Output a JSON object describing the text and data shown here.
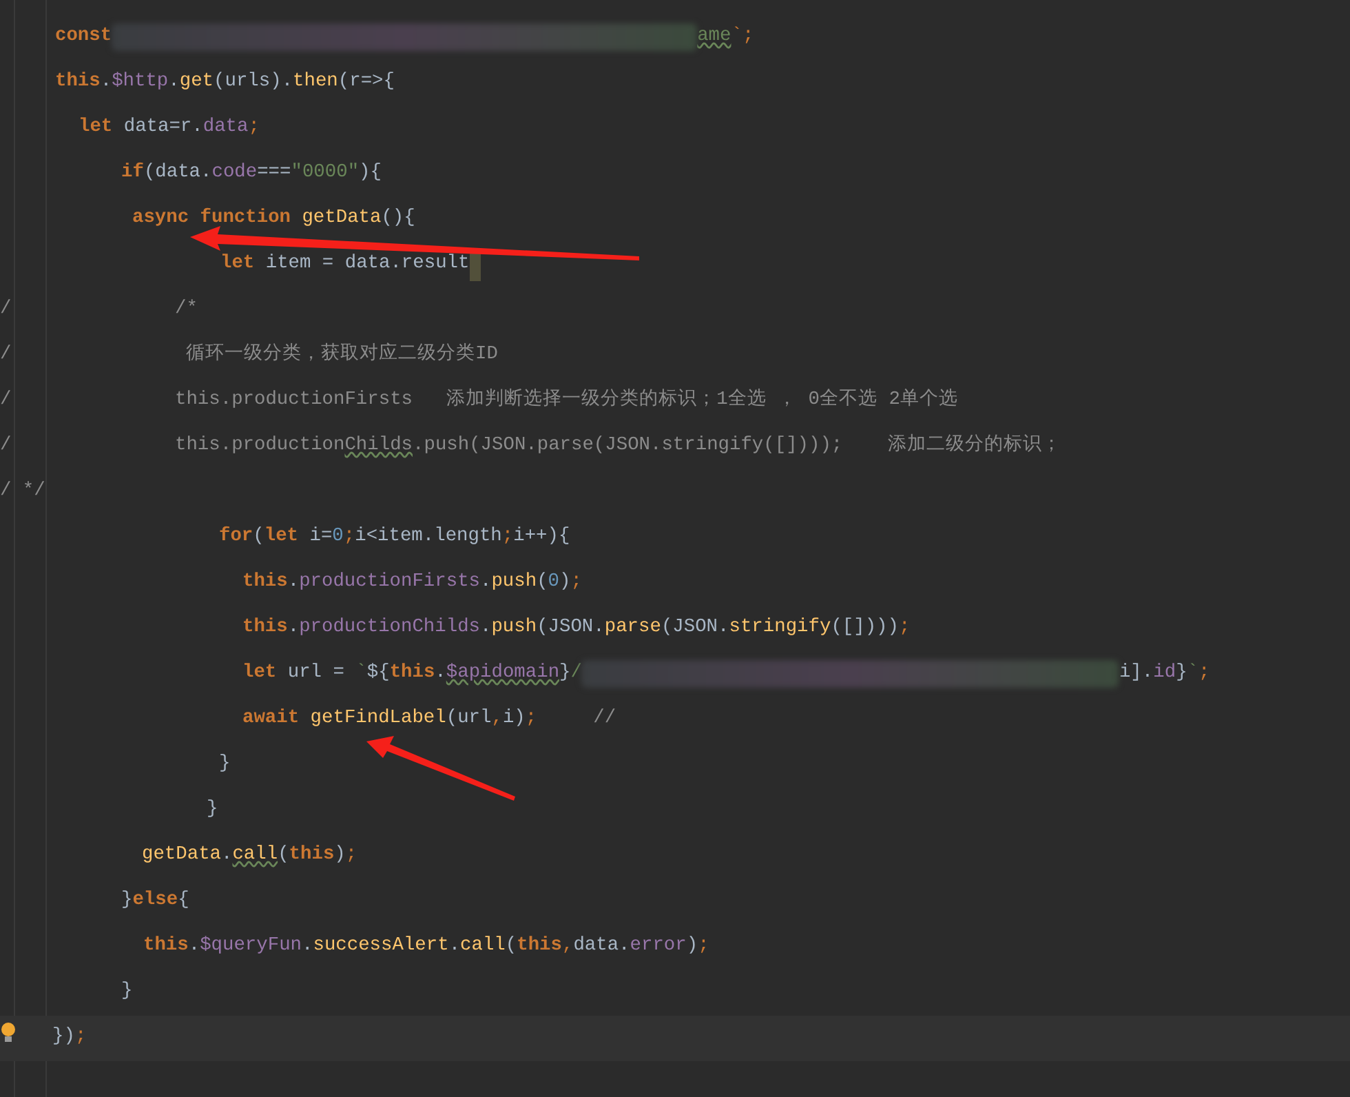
{
  "lines": [
    {
      "tokens": [
        {
          "kind": "kw",
          "t": "const"
        },
        {
          "kind": "blur"
        },
        {
          "kind": "str",
          "t": "ame",
          "warn": true
        },
        {
          "kind": "punct",
          "t": "`;"
        }
      ]
    },
    {
      "tokens": [
        {
          "kind": "kw",
          "t": "this"
        },
        {
          "kind": "plain",
          "t": "."
        },
        {
          "kind": "prop",
          "t": "$http"
        },
        {
          "kind": "plain",
          "t": "."
        },
        {
          "kind": "fn",
          "t": "get"
        },
        {
          "kind": "plain",
          "t": "(urls)."
        },
        {
          "kind": "fn",
          "t": "then"
        },
        {
          "kind": "plain",
          "t": "(r=>{"
        }
      ]
    },
    {
      "tokens": [
        {
          "kind": "kw",
          "t": "let "
        },
        {
          "kind": "plain",
          "t": "data=r."
        },
        {
          "kind": "prop",
          "t": "data"
        },
        {
          "kind": "punct",
          "t": ";"
        }
      ]
    },
    {
      "tokens": [
        {
          "kind": "kw",
          "t": "if"
        },
        {
          "kind": "plain",
          "t": "(data."
        },
        {
          "kind": "prop",
          "t": "code"
        },
        {
          "kind": "plain",
          "t": "==="
        },
        {
          "kind": "str",
          "t": "\"0000\""
        },
        {
          "kind": "plain",
          "t": "){"
        }
      ]
    },
    {
      "tokens": [
        {
          "kind": "kw",
          "t": "async function "
        },
        {
          "kind": "fn",
          "t": "getData"
        },
        {
          "kind": "plain",
          "t": "(){"
        }
      ]
    },
    {
      "cursor": true,
      "tokens": [
        {
          "kind": "kw",
          "t": "let "
        },
        {
          "kind": "plain",
          "t": "item = data.result"
        }
      ]
    },
    {
      "gutter": "/",
      "tokens": [
        {
          "kind": "cmt",
          "t": "/*"
        }
      ]
    },
    {
      "gutter": "/",
      "tokens": [
        {
          "kind": "cmt",
          "t": "循环一级分类，获取对应二级分类ID"
        }
      ]
    },
    {
      "gutter": "/",
      "tokens": [
        {
          "kind": "cmt",
          "t": "this.productionFirsts   添加判断选择一级分类的标识；1全选 ， 0全不选 2单个选"
        }
      ]
    },
    {
      "gutter": "/",
      "tokens": [
        {
          "kind": "cmt",
          "t": "this.production"
        },
        {
          "kind": "cmt",
          "t": "Childs",
          "warn": true
        },
        {
          "kind": "cmt",
          "t": ".push(JSON.parse(JSON.stringify([])));    添加二级分的标识；"
        }
      ]
    },
    {
      "gutter": "/ */"
    },
    {
      "tokens": [
        {
          "kind": "kw",
          "t": "for"
        },
        {
          "kind": "plain",
          "t": "("
        },
        {
          "kind": "kw",
          "t": "let "
        },
        {
          "kind": "plain",
          "t": "i="
        },
        {
          "kind": "num",
          "t": "0"
        },
        {
          "kind": "punct",
          "t": ";"
        },
        {
          "kind": "plain",
          "t": "i<item.length"
        },
        {
          "kind": "punct",
          "t": ";"
        },
        {
          "kind": "plain",
          "t": "i++){"
        }
      ]
    },
    {
      "tokens": [
        {
          "kind": "kw",
          "t": "this"
        },
        {
          "kind": "plain",
          "t": "."
        },
        {
          "kind": "prop",
          "t": "productionFirsts"
        },
        {
          "kind": "plain",
          "t": "."
        },
        {
          "kind": "fn",
          "t": "push"
        },
        {
          "kind": "plain",
          "t": "("
        },
        {
          "kind": "num",
          "t": "0"
        },
        {
          "kind": "plain",
          "t": ")"
        },
        {
          "kind": "punct",
          "t": ";"
        }
      ]
    },
    {
      "tokens": [
        {
          "kind": "kw",
          "t": "this"
        },
        {
          "kind": "plain",
          "t": "."
        },
        {
          "kind": "prop",
          "t": "productionChilds"
        },
        {
          "kind": "plain",
          "t": "."
        },
        {
          "kind": "fn",
          "t": "push"
        },
        {
          "kind": "plain",
          "t": "(JSON."
        },
        {
          "kind": "fn",
          "t": "parse"
        },
        {
          "kind": "plain",
          "t": "(JSON."
        },
        {
          "kind": "fn",
          "t": "stringify"
        },
        {
          "kind": "plain",
          "t": "([])))"
        },
        {
          "kind": "punct",
          "t": ";"
        }
      ]
    },
    {
      "tokens": [
        {
          "kind": "kw",
          "t": "let "
        },
        {
          "kind": "plain",
          "t": "url = "
        },
        {
          "kind": "str",
          "t": "`"
        },
        {
          "kind": "plain",
          "t": "${"
        },
        {
          "kind": "kw",
          "t": "this"
        },
        {
          "kind": "plain",
          "t": "."
        },
        {
          "kind": "prop",
          "t": "$apidomain",
          "warn": true
        },
        {
          "kind": "plain",
          "t": "}"
        },
        {
          "kind": "str",
          "t": "/"
        },
        {
          "kind": "blur"
        },
        {
          "kind": "plain",
          "t": "i]."
        },
        {
          "kind": "prop",
          "t": "id"
        },
        {
          "kind": "plain",
          "t": "}"
        },
        {
          "kind": "str",
          "t": "`"
        },
        {
          "kind": "punct",
          "t": ";"
        }
      ]
    },
    {
      "tokens": [
        {
          "kind": "kw",
          "t": "await "
        },
        {
          "kind": "fn",
          "t": "getFindLabel"
        },
        {
          "kind": "plain",
          "t": "(url"
        },
        {
          "kind": "punct",
          "t": ","
        },
        {
          "kind": "plain",
          "t": "i)"
        },
        {
          "kind": "punct",
          "t": ";"
        },
        {
          "kind": "cmt",
          "t": "     //"
        }
      ]
    },
    {
      "tokens": [
        {
          "kind": "plain",
          "t": "}"
        }
      ]
    },
    {
      "tokens": [
        {
          "kind": "plain",
          "t": "}"
        }
      ]
    },
    {
      "tokens": [
        {
          "kind": "fn",
          "t": "getData"
        },
        {
          "kind": "plain",
          "t": "."
        },
        {
          "kind": "fn",
          "t": "call",
          "warn": true
        },
        {
          "kind": "plain",
          "t": "("
        },
        {
          "kind": "kw",
          "t": "this"
        },
        {
          "kind": "plain",
          "t": ")"
        },
        {
          "kind": "punct",
          "t": ";"
        }
      ]
    },
    {
      "tokens": [
        {
          "kind": "plain",
          "t": "}"
        },
        {
          "kind": "kw",
          "t": "else"
        },
        {
          "kind": "plain",
          "t": "{"
        }
      ]
    },
    {
      "tokens": [
        {
          "kind": "kw",
          "t": "this"
        },
        {
          "kind": "plain",
          "t": "."
        },
        {
          "kind": "prop",
          "t": "$queryFun"
        },
        {
          "kind": "plain",
          "t": "."
        },
        {
          "kind": "fn",
          "t": "successAlert"
        },
        {
          "kind": "plain",
          "t": "."
        },
        {
          "kind": "fn",
          "t": "call"
        },
        {
          "kind": "plain",
          "t": "("
        },
        {
          "kind": "kw",
          "t": "this"
        },
        {
          "kind": "punct",
          "t": ","
        },
        {
          "kind": "plain",
          "t": "data."
        },
        {
          "kind": "prop",
          "t": "error"
        },
        {
          "kind": "plain",
          "t": ")"
        },
        {
          "kind": "punct",
          "t": ";"
        }
      ]
    },
    {
      "tokens": [
        {
          "kind": "plain",
          "t": "}"
        }
      ]
    },
    {
      "current": true,
      "tokens": [
        {
          "kind": "plain",
          "t": "})"
        },
        {
          "kind": "punct",
          "t": ";"
        }
      ]
    }
  ]
}
